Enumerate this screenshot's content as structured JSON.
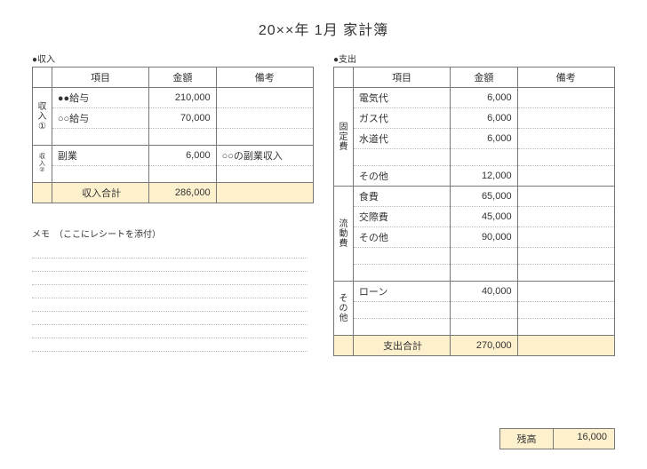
{
  "title": "20××年 1月 家計簿",
  "labels": {
    "income_section": "●収入",
    "expense_section": "●支出",
    "item": "項目",
    "amount": "金額",
    "note": "備考",
    "income_group1": "収入①",
    "income_group2": "収入②",
    "fixed": "固定費",
    "variable": "流動費",
    "other": "その他",
    "income_total_label": "収入合計",
    "expense_total_label": "支出合計",
    "balance_label": "残高",
    "memo_title": "メモ　（ここにレシートを添付）"
  },
  "income": {
    "group1": [
      {
        "item": "●●給与",
        "amount": "210,000",
        "note": ""
      },
      {
        "item": "○○給与",
        "amount": "70,000",
        "note": ""
      },
      {
        "item": "",
        "amount": "",
        "note": ""
      }
    ],
    "group2": [
      {
        "item": "副業",
        "amount": "6,000",
        "note": "○○の副業収入"
      },
      {
        "item": "",
        "amount": "",
        "note": ""
      }
    ],
    "total": "286,000"
  },
  "expense": {
    "fixed": [
      {
        "item": "電気代",
        "amount": "6,000",
        "note": ""
      },
      {
        "item": "ガス代",
        "amount": "6,000",
        "note": ""
      },
      {
        "item": "水道代",
        "amount": "6,000",
        "note": ""
      },
      {
        "item": "",
        "amount": "",
        "note": ""
      },
      {
        "item": "その他",
        "amount": "12,000",
        "note": ""
      }
    ],
    "variable": [
      {
        "item": "食費",
        "amount": "65,000",
        "note": ""
      },
      {
        "item": "交際費",
        "amount": "45,000",
        "note": ""
      },
      {
        "item": "その他",
        "amount": "90,000",
        "note": ""
      },
      {
        "item": "",
        "amount": "",
        "note": ""
      },
      {
        "item": "",
        "amount": "",
        "note": ""
      }
    ],
    "other": [
      {
        "item": "ローン",
        "amount": "40,000",
        "note": ""
      },
      {
        "item": "",
        "amount": "",
        "note": ""
      },
      {
        "item": "",
        "amount": "",
        "note": ""
      }
    ],
    "total": "270,000"
  },
  "balance": "16,000"
}
